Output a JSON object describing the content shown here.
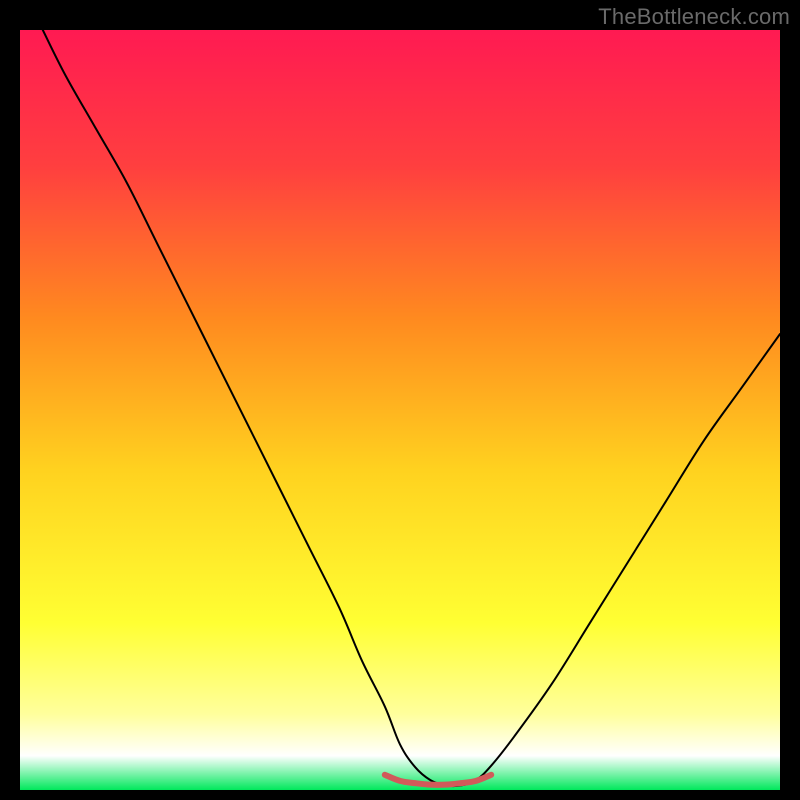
{
  "watermark": "TheBottleneck.com",
  "chart_data": {
    "type": "line",
    "title": "",
    "xlabel": "",
    "ylabel": "",
    "xlim": [
      0,
      100
    ],
    "ylim": [
      0,
      100
    ],
    "background_gradient": {
      "stops": [
        {
          "offset": 0.0,
          "color": "#ff1a52"
        },
        {
          "offset": 0.18,
          "color": "#ff3f3f"
        },
        {
          "offset": 0.38,
          "color": "#ff8a1f"
        },
        {
          "offset": 0.58,
          "color": "#ffd21f"
        },
        {
          "offset": 0.78,
          "color": "#ffff33"
        },
        {
          "offset": 0.9,
          "color": "#ffff9c"
        },
        {
          "offset": 0.955,
          "color": "#ffffff"
        },
        {
          "offset": 1.0,
          "color": "#00e85c"
        }
      ]
    },
    "series": [
      {
        "name": "bottleneck-curve",
        "color": "#000000",
        "width": 2,
        "x": [
          3,
          6,
          10,
          14,
          18,
          22,
          26,
          30,
          34,
          38,
          42,
          45,
          48,
          50,
          52,
          54,
          56,
          58,
          60,
          62,
          65,
          70,
          75,
          80,
          85,
          90,
          95,
          100
        ],
        "y": [
          100,
          94,
          87,
          80,
          72,
          64,
          56,
          48,
          40,
          32,
          24,
          17,
          11,
          6,
          3,
          1.3,
          0.6,
          0.6,
          1.3,
          3.2,
          7,
          14,
          22,
          30,
          38,
          46,
          53,
          60
        ]
      },
      {
        "name": "recommended-range",
        "color": "#d15a5a",
        "width": 6,
        "x": [
          48,
          50,
          52,
          54,
          56,
          58,
          60,
          62
        ],
        "y": [
          2.0,
          1.2,
          0.9,
          0.7,
          0.7,
          0.9,
          1.2,
          2.0
        ]
      }
    ]
  }
}
